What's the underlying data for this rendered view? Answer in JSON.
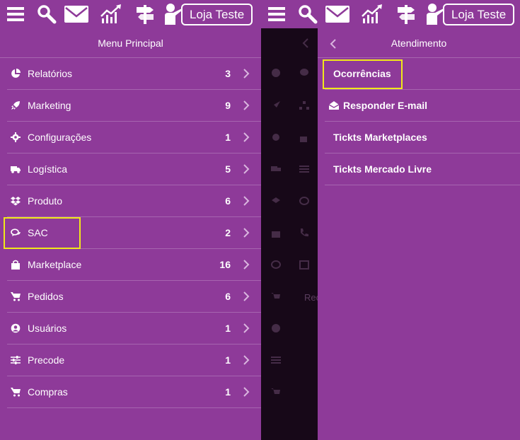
{
  "topbar": {
    "store_label": "Loja Teste",
    "icons": [
      "menu-icon",
      "search-icon",
      "mail-icon",
      "chart-icon",
      "signpost-icon",
      "user-presenter-icon"
    ]
  },
  "left_menu": {
    "title": "Menu Principal",
    "items": [
      {
        "label": "Relatórios",
        "count": "3",
        "icon": "pie-chart-icon"
      },
      {
        "label": "Marketing",
        "count": "9",
        "icon": "rocket-icon"
      },
      {
        "label": "Configurações",
        "count": "1",
        "icon": "gear-icon"
      },
      {
        "label": "Logística",
        "count": "5",
        "icon": "truck-icon"
      },
      {
        "label": "Produto",
        "count": "6",
        "icon": "dropbox-icon"
      },
      {
        "label": "SAC",
        "count": "2",
        "icon": "chat-bubbles-icon"
      },
      {
        "label": "Marketplace",
        "count": "16",
        "icon": "shopping-bag-icon"
      },
      {
        "label": "Pedidos",
        "count": "6",
        "icon": "cart-icon"
      },
      {
        "label": "Usuários",
        "count": "1",
        "icon": "user-circle-icon"
      },
      {
        "label": "Precode",
        "count": "1",
        "icon": "sliders-icon"
      },
      {
        "label": "Compras",
        "count": "1",
        "icon": "cart-icon"
      }
    ]
  },
  "right_menu": {
    "title": "Atendimento",
    "items": [
      {
        "label": "Ocorrências"
      },
      {
        "label": "Responder E-mail",
        "icon": "envelope-open-icon"
      },
      {
        "label": "Tickts Marketplaces"
      },
      {
        "label": "Tickts Mercado Livre"
      }
    ]
  },
  "middle_panel": {
    "partial_label": "Rec"
  },
  "colors": {
    "background": "#8e3a99",
    "divider": "#a765b0",
    "highlight": "#f0e81a",
    "dark_overlay": "#170818"
  }
}
